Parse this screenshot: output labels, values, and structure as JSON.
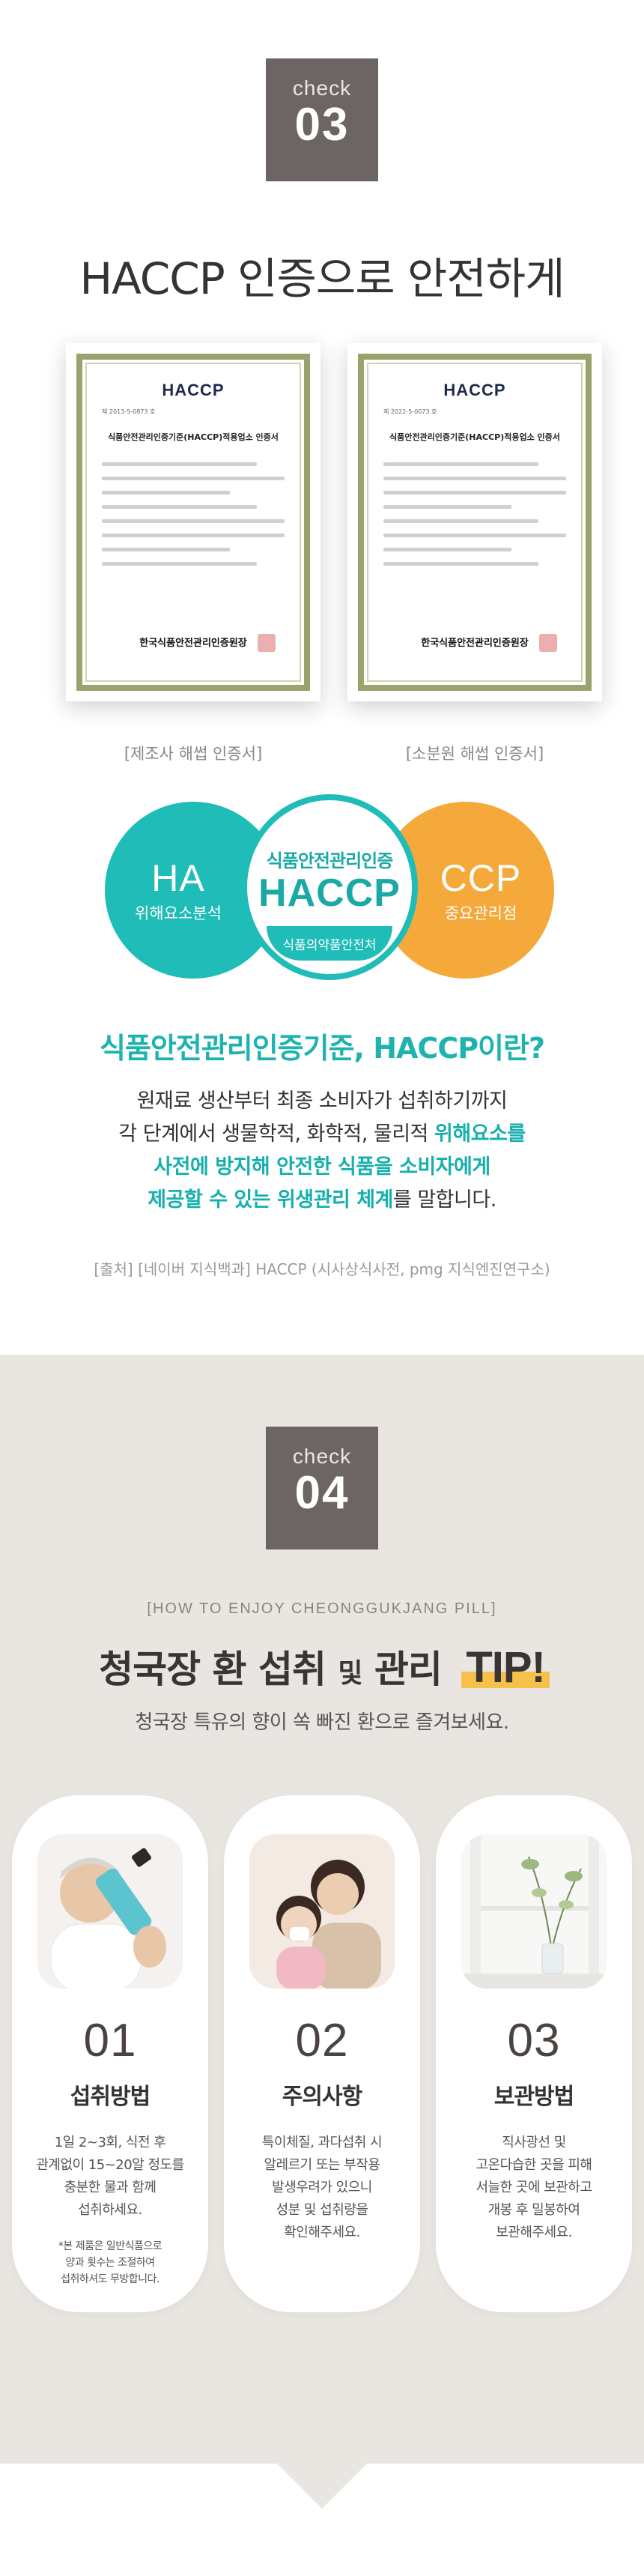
{
  "section1": {
    "check_label": "check",
    "check_number": "03",
    "title": "HACCP 인증으로 안전하게",
    "certificates": [
      {
        "logo": "HACCP",
        "doc_no": "제 2013-5-0873 호",
        "doc_title": "식품안전관리인증기준(HACCP)적용업소 인증서",
        "issuer": "한국식품안전관리인증원장",
        "caption": "[제조사 해썹 인증서]"
      },
      {
        "logo": "HACCP",
        "doc_no": "제 2022-5-0073 호",
        "doc_title": "식품안전관리인증기준(HACCP)적용업소 인증서",
        "issuer": "한국식품안전관리인증원장",
        "caption": "[소분원 해썹 인증서]"
      }
    ],
    "diagram": {
      "left": {
        "big": "HA",
        "sub": "위해요소분석",
        "color": "#1fbcb8"
      },
      "center": {
        "top": "식품안전관리인증",
        "logo": "HACCP",
        "bottom": "식품의약품안전처",
        "color": "#1fbcb8"
      },
      "right": {
        "big": "CCP",
        "sub": "중요관리점",
        "color": "#f5a93b"
      }
    },
    "question": "식품안전관리인증기준, HACCP이란?",
    "description": {
      "line1": "원재료 생산부터 최종 소비자가 섭취하기까지",
      "line2a": "각 단계에서 생물학적, 화학적, 물리적 ",
      "line2b": "위해요소를",
      "line3": "사전에 방지해 안전한 식품을 소비자에게",
      "line4a": "제공할 수 있는 위생관리 체계",
      "line4b": "를 말합니다."
    },
    "source": "[출처] [네이버 지식백과] HACCP (시사상식사전, pmg 지식엔진연구소)"
  },
  "section2": {
    "check_label": "check",
    "check_number": "04",
    "howto": "[HOW TO ENJOY CHEONGGUKJANG PILL]",
    "title_a": "청국장 환 섭취 ",
    "title_small": "및",
    "title_b": " 관리 ",
    "title_tip": "TIP!",
    "subtitle": "청국장 특유의 향이 쏙 빠진 환으로 즐겨보세요.",
    "accent_color": "#f6c04a",
    "cards": [
      {
        "num": "01",
        "name": "섭취방법",
        "body": [
          "1일 2~3회, 식전 후",
          "관계없이 15~20알 정도를",
          "충분한 물과 함께",
          "섭취하세요."
        ],
        "note": [
          "*본 제품은 일반식품으로",
          "양과 횟수는 조절하여",
          "섭취하셔도 무방합니다."
        ]
      },
      {
        "num": "02",
        "name": "주의사항",
        "body": [
          "특이체질, 과다섭취 시",
          "알레르기 또는 부작용",
          "발생우려가 있으니",
          "성분 및 섭취량을",
          "확인해주세요."
        ],
        "note": []
      },
      {
        "num": "03",
        "name": "보관방법",
        "body": [
          "직사광선 및",
          "고온다습한 곳을 피해",
          "서늘한 곳에 보관하고",
          "개봉 후 밀봉하여",
          "보관해주세요."
        ],
        "note": []
      }
    ]
  }
}
